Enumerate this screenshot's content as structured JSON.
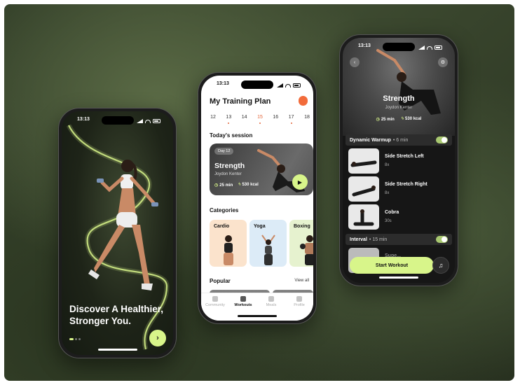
{
  "colors": {
    "accent": "#d8f58a",
    "orange": "#f26b3a",
    "bg_dark": "#2f3b26"
  },
  "phone1": {
    "time": "13:13",
    "headline": "Discover A Healthier, Stronger You.",
    "next_icon": "chevron-right-icon",
    "next_glyph": "›"
  },
  "phone2": {
    "time": "13:13",
    "title": "My Training Plan",
    "dates": [
      "12",
      "13",
      "14",
      "15",
      "16",
      "17",
      "18"
    ],
    "todays_session_label": "Today's session",
    "session": {
      "day": "Day 12",
      "name": "Strength",
      "coach": "Joydon Kenter",
      "duration": "25 min",
      "calories": "530 kcal"
    },
    "categories_label": "Categories",
    "categories": [
      "Cardio",
      "Yoga",
      "Boxing"
    ],
    "popular_label": "Popular",
    "view_all": "View all",
    "tabs": [
      "Community",
      "Workouts",
      "Meals",
      "Profile"
    ]
  },
  "phone3": {
    "time": "13:13",
    "name": "Strength",
    "coach": "Joydon Kenter",
    "duration": "25 min",
    "calories": "530 kcal",
    "warmup_label": "Dynamic Warmup",
    "warmup_duration": "6 min",
    "exercises": [
      {
        "name": "Side Stretch Left",
        "reps": "8x"
      },
      {
        "name": "Side Stretch Right",
        "reps": "8x"
      },
      {
        "name": "Cobra",
        "reps": "30s"
      }
    ],
    "interval_label": "Interval",
    "interval_duration": "15 min",
    "next_exercise_partial": "Supe...",
    "start_button": "Start Workout",
    "back_glyph": "‹",
    "settings_glyph": "⚙",
    "music_glyph": "♫"
  }
}
